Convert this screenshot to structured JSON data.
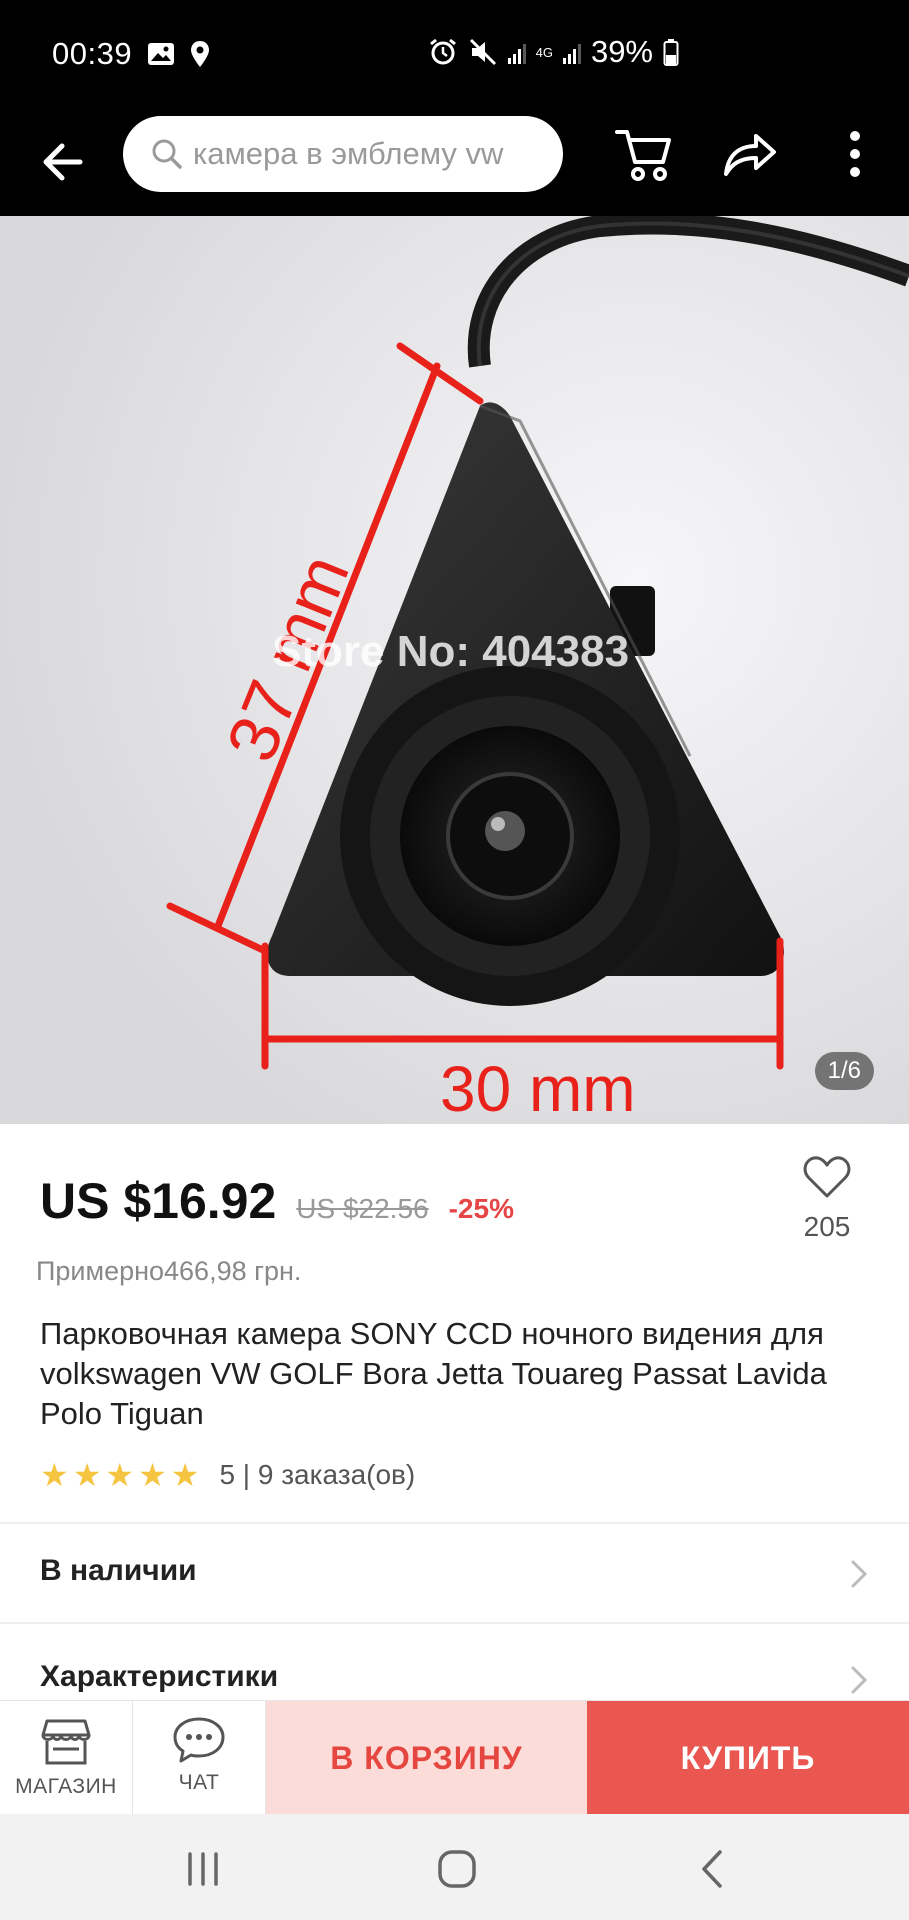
{
  "status_bar": {
    "time": "00:39",
    "battery": "39%",
    "network": "4G"
  },
  "nav": {
    "search_placeholder": "камера в эмблему vw"
  },
  "hero": {
    "image_counter": "1/6",
    "watermark": "Store No: 404383",
    "dimension_height": "37 mm",
    "dimension_width": "30 mm"
  },
  "product": {
    "price": "US $16.92",
    "old_price": "US $22.56",
    "discount": "-25%",
    "wishlist_count": "205",
    "approx_price": "Примерно466,98 грн.",
    "title": "Парковочная камера SONY CCD ночного видения для volkswagen VW GOLF Bora Jetta Touareg Passat Lavida Polo Tiguan",
    "rating_text": "5 | 9 заказа(ов)",
    "stars": 5
  },
  "sections": {
    "availability": "В наличии",
    "specs": "Характеристики"
  },
  "action_bar": {
    "store_label": "МАГАЗИН",
    "chat_label": "ЧАТ",
    "cart_label": "В КОРЗИНУ",
    "buy_label": "КУПИТЬ"
  },
  "colors": {
    "accent": "#ea5650",
    "accent_light": "#fbdcd8",
    "star": "#f5c542",
    "discount": "#e64545"
  }
}
